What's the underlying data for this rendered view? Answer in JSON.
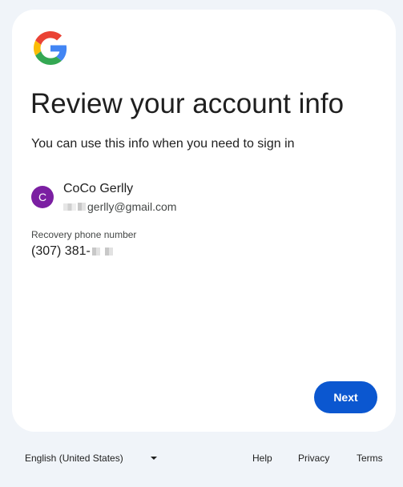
{
  "logo": {
    "icon": "google-g-icon",
    "colors": [
      "#4285F4",
      "#EA4335",
      "#FBBC05",
      "#34A853"
    ]
  },
  "title": "Review your account info",
  "subtitle": "You can use this info when you need to sign in",
  "account": {
    "avatar_letter": "C",
    "avatar_color": "#7b1fa2",
    "name": "CoCo Gerlly",
    "email_visible": "gerlly@gmail.com"
  },
  "recovery": {
    "label": "Recovery phone number",
    "phone_visible": "(307) 381-"
  },
  "actions": {
    "next_label": "Next",
    "next_color": "#0b57d0"
  },
  "footer": {
    "language": "English (United States)",
    "links": [
      "Help",
      "Privacy",
      "Terms"
    ]
  }
}
